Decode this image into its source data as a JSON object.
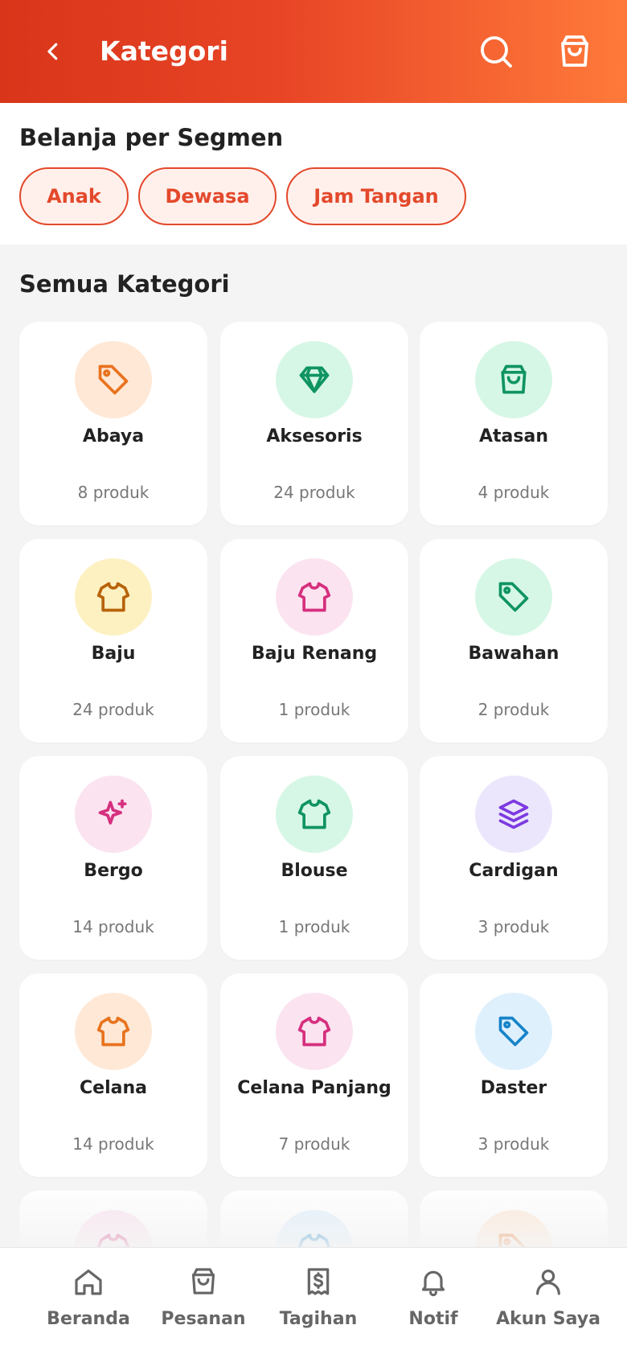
{
  "header": {
    "title": "Kategori",
    "back_icon": "back-arrow-icon",
    "search_icon": "search-icon",
    "cart_icon": "shopping-bag-icon"
  },
  "segment": {
    "title": "Belanja per Segmen",
    "chips": [
      "Anak",
      "Dewasa",
      "Jam Tangan"
    ]
  },
  "categories_title": "Semua Kategori",
  "categories": [
    {
      "name": "Abaya",
      "count": "8 produk",
      "icon": "tag-icon",
      "color": "#e8731f",
      "bg": "#ffe8d6"
    },
    {
      "name": "Aksesoris",
      "count": "24 produk",
      "icon": "diamond-icon",
      "color": "#0f9460",
      "bg": "#d7f7e6"
    },
    {
      "name": "Atasan",
      "count": "4 produk",
      "icon": "shopping-bag-icon",
      "color": "#0f9460",
      "bg": "#d7f7e6"
    },
    {
      "name": "Baju",
      "count": "24 produk",
      "icon": "shirt-icon",
      "color": "#b8630a",
      "bg": "#fdf1c2"
    },
    {
      "name": "Baju Renang",
      "count": "1 produk",
      "icon": "shirt-icon",
      "color": "#d62f7e",
      "bg": "#fbe3f0"
    },
    {
      "name": "Bawahan",
      "count": "2 produk",
      "icon": "tag-icon",
      "color": "#0f9460",
      "bg": "#d7f7e6"
    },
    {
      "name": "Bergo",
      "count": "14 produk",
      "icon": "sparkles-icon",
      "color": "#d62f7e",
      "bg": "#fbe3f0"
    },
    {
      "name": "Blouse",
      "count": "1 produk",
      "icon": "shirt-icon",
      "color": "#0f9460",
      "bg": "#d7f7e6"
    },
    {
      "name": "Cardigan",
      "count": "3 produk",
      "icon": "layers-icon",
      "color": "#7c3ae0",
      "bg": "#ece6fd"
    },
    {
      "name": "Celana",
      "count": "14 produk",
      "icon": "shirt-icon",
      "color": "#e8731f",
      "bg": "#ffe8d6"
    },
    {
      "name": "Celana Panjang",
      "count": "7 produk",
      "icon": "shirt-icon",
      "color": "#d62f7e",
      "bg": "#fbe3f0"
    },
    {
      "name": "Daster",
      "count": "3 produk",
      "icon": "tag-icon",
      "color": "#1684c9",
      "bg": "#dff0fd"
    },
    {
      "name": "",
      "count": "",
      "icon": "shirt-icon",
      "color": "#d62f7e",
      "bg": "#fbe3f0"
    },
    {
      "name": "",
      "count": "",
      "icon": "shirt-icon",
      "color": "#1684c9",
      "bg": "#dff0fd"
    },
    {
      "name": "",
      "count": "",
      "icon": "tag-icon",
      "color": "#e8731f",
      "bg": "#ffe8d6"
    }
  ],
  "bottom_nav": [
    {
      "label": "Beranda",
      "icon": "home-icon"
    },
    {
      "label": "Pesanan",
      "icon": "shopping-bag-icon"
    },
    {
      "label": "Tagihan",
      "icon": "receipt-icon"
    },
    {
      "label": "Notif",
      "icon": "bell-icon"
    },
    {
      "label": "Akun Saya",
      "icon": "user-icon"
    }
  ],
  "colors": {
    "accent": "#e3492b",
    "header_start": "#d9351a",
    "header_end": "#ff7a3a",
    "nav_inactive": "#666666"
  }
}
